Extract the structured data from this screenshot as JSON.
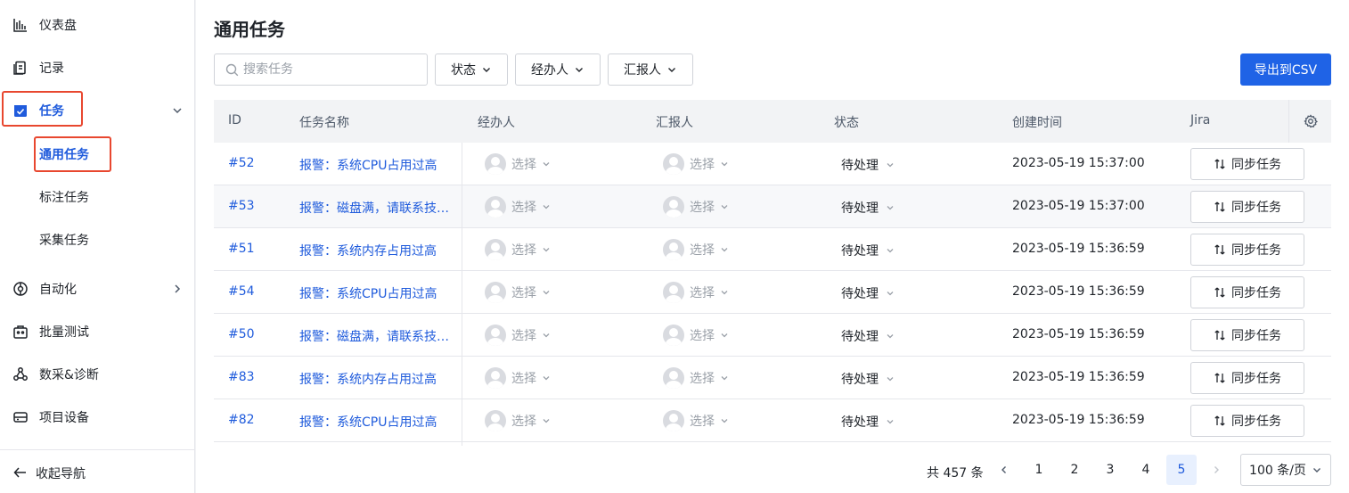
{
  "sidebar": {
    "items": [
      {
        "label": "仪表盘",
        "icon": "bar-chart-icon"
      },
      {
        "label": "记录",
        "icon": "clipboard-icon"
      },
      {
        "label": "任务",
        "icon": "task-icon"
      },
      {
        "label": "自动化",
        "icon": "robot-icon"
      },
      {
        "label": "批量测试",
        "icon": "toolbox-icon"
      },
      {
        "label": "数采&诊断",
        "icon": "data-diagnose-icon"
      },
      {
        "label": "项目设备",
        "icon": "device-icon"
      }
    ],
    "sub_items": [
      {
        "label": "通用任务"
      },
      {
        "label": "标注任务"
      },
      {
        "label": "采集任务"
      }
    ],
    "collapse_label": "收起导航",
    "accent": "#1f5bdc",
    "highlight": "#e8472f"
  },
  "header": {
    "title": "通用任务"
  },
  "filters": {
    "search_placeholder": "搜索任务",
    "status_label": "状态",
    "assignee_label": "经办人",
    "reporter_label": "汇报人",
    "export_label": "导出到CSV"
  },
  "table": {
    "columns": [
      "ID",
      "任务名称",
      "经办人",
      "汇报人",
      "状态",
      "创建时间",
      "Jira"
    ],
    "rows": [
      {
        "id": "#52",
        "name": "报警：系统CPU占用过高",
        "assignee": "选择",
        "reporter": "选择",
        "status": "待处理",
        "created": "2023-05-19 15:37:00",
        "jira": "同步任务"
      },
      {
        "id": "#53",
        "name": "报警：磁盘满，请联系技术支持",
        "assignee": "选择",
        "reporter": "选择",
        "status": "待处理",
        "created": "2023-05-19 15:37:00",
        "jira": "同步任务"
      },
      {
        "id": "#51",
        "name": "报警：系统内存占用过高",
        "assignee": "选择",
        "reporter": "选择",
        "status": "待处理",
        "created": "2023-05-19 15:36:59",
        "jira": "同步任务"
      },
      {
        "id": "#54",
        "name": "报警：系统CPU占用过高",
        "assignee": "选择",
        "reporter": "选择",
        "status": "待处理",
        "created": "2023-05-19 15:36:59",
        "jira": "同步任务"
      },
      {
        "id": "#50",
        "name": "报警：磁盘满，请联系技术支持",
        "assignee": "选择",
        "reporter": "选择",
        "status": "待处理",
        "created": "2023-05-19 15:36:59",
        "jira": "同步任务"
      },
      {
        "id": "#83",
        "name": "报警：系统内存占用过高",
        "assignee": "选择",
        "reporter": "选择",
        "status": "待处理",
        "created": "2023-05-19 15:36:59",
        "jira": "同步任务"
      },
      {
        "id": "#82",
        "name": "报警：系统CPU占用过高",
        "assignee": "选择",
        "reporter": "选择",
        "status": "待处理",
        "created": "2023-05-19 15:36:59",
        "jira": "同步任务"
      }
    ]
  },
  "pagination": {
    "total": "共 457 条",
    "pages": [
      "1",
      "2",
      "3",
      "4",
      "5"
    ],
    "current": "5",
    "page_size": "100 条/页"
  }
}
